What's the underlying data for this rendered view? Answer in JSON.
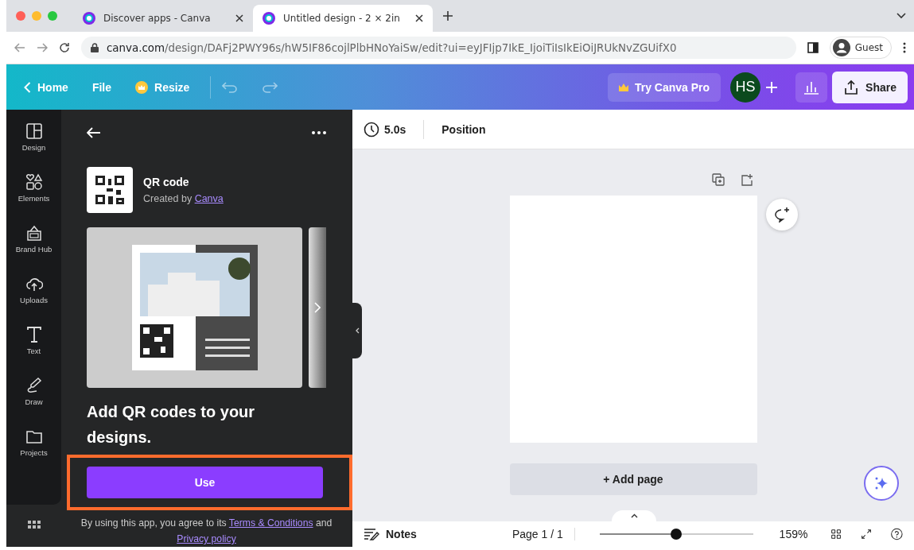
{
  "browser": {
    "tabs": [
      {
        "title": "Discover apps - Canva",
        "selected": false
      },
      {
        "title": "Untitled design - 2 × 2in",
        "selected": true
      }
    ],
    "url_host": "canva.com",
    "url_path": "/design/DAFj2PWY96s/hW5IF86cojlPlbHNoYaiSw/edit?ui=eyJFIjp7IkE_IjoiTiIsIkEiOiJRUkNvZGUifX0",
    "profile": "Guest"
  },
  "toolbar": {
    "home": "Home",
    "file": "File",
    "resize": "Resize",
    "try_pro": "Try Canva Pro",
    "avatar": "HS",
    "share": "Share"
  },
  "rail": {
    "items": [
      {
        "label": "Design"
      },
      {
        "label": "Elements"
      },
      {
        "label": "Brand Hub"
      },
      {
        "label": "Uploads"
      },
      {
        "label": "Text"
      },
      {
        "label": "Draw"
      },
      {
        "label": "Projects"
      }
    ]
  },
  "app_panel": {
    "title": "QR code",
    "created_by": "Created by",
    "creator": "Canva",
    "headline": "Add QR codes to your designs.",
    "use_button": "Use",
    "highlighted": true,
    "disclaimer": [
      "By using this app, you agree to its",
      "Terms & Conditions",
      "and",
      "Privacy policy"
    ]
  },
  "editor": {
    "duration": "5.0s",
    "position": "Position",
    "add_page": "+ Add page",
    "notes": "Notes",
    "page": "Page 1 / 1",
    "zoom": {
      "level": 0.5,
      "reading": "159%"
    }
  }
}
